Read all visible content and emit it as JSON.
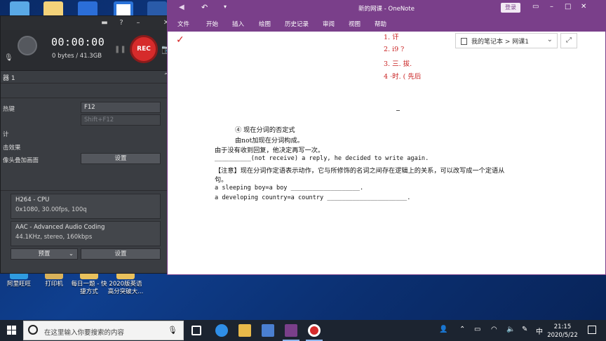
{
  "desktop": {
    "bottom_icons": [
      {
        "label": "阿里旺旺"
      },
      {
        "label": "打印机"
      },
      {
        "label": "每日一题 - 快捷方式"
      },
      {
        "label": "2020版英语高分突破大..."
      }
    ]
  },
  "recorder": {
    "timer": "00:00:00",
    "bytes": "0 bytes / 41.3GB",
    "rec_label": "REC",
    "device_label": "器 1",
    "hotkey_label": "热键",
    "hotkey_value": "F12",
    "hotkey_alt": "Shift+F12",
    "row_count_label": "计",
    "row_click_label": "击效果",
    "row_overlay_label": "像头叠加画面",
    "settings_label": "设置",
    "video_codec": "H264 - CPU",
    "video_detail": "0x1080, 30.00fps, 100q",
    "audio_codec": "AAC - Advanced Audio Coding",
    "audio_detail": "44.1KHz, stereo, 160kbps",
    "preset_label": "预置",
    "settings2_label": "设置"
  },
  "onenote": {
    "title": "新的网课 - OneNote",
    "login_label": "登录",
    "menu": [
      "文件",
      "开始",
      "插入",
      "绘图",
      "历史记录",
      "审阅",
      "视图",
      "帮助"
    ],
    "notebook_path": "我的笔记本 > 网课1",
    "handwriting": [
      "1.  讦",
      "2.  i9 ?",
      "3.  三. 拔.",
      "4  ·时. ( 先后"
    ],
    "note_lines": [
      "④ 现在分词的否定式",
      "由not加现在分词构成。",
      "由于没有收到回复，他决定再写一次。",
      "__________(not receive) a reply, he decided to write again.",
      "【注意】现在分词作定语表示动作，它与所修饰的名词之间存在逻辑上的关系，可以改写成一个定语从",
      "句。",
      "a sleeping boy=a boy ___________________.",
      "a developing country=a country ______________________."
    ]
  },
  "taskbar": {
    "search_placeholder": "在这里输入你要搜索的内容",
    "time": "21:15",
    "date": "2020/5/22",
    "lang": "中"
  }
}
